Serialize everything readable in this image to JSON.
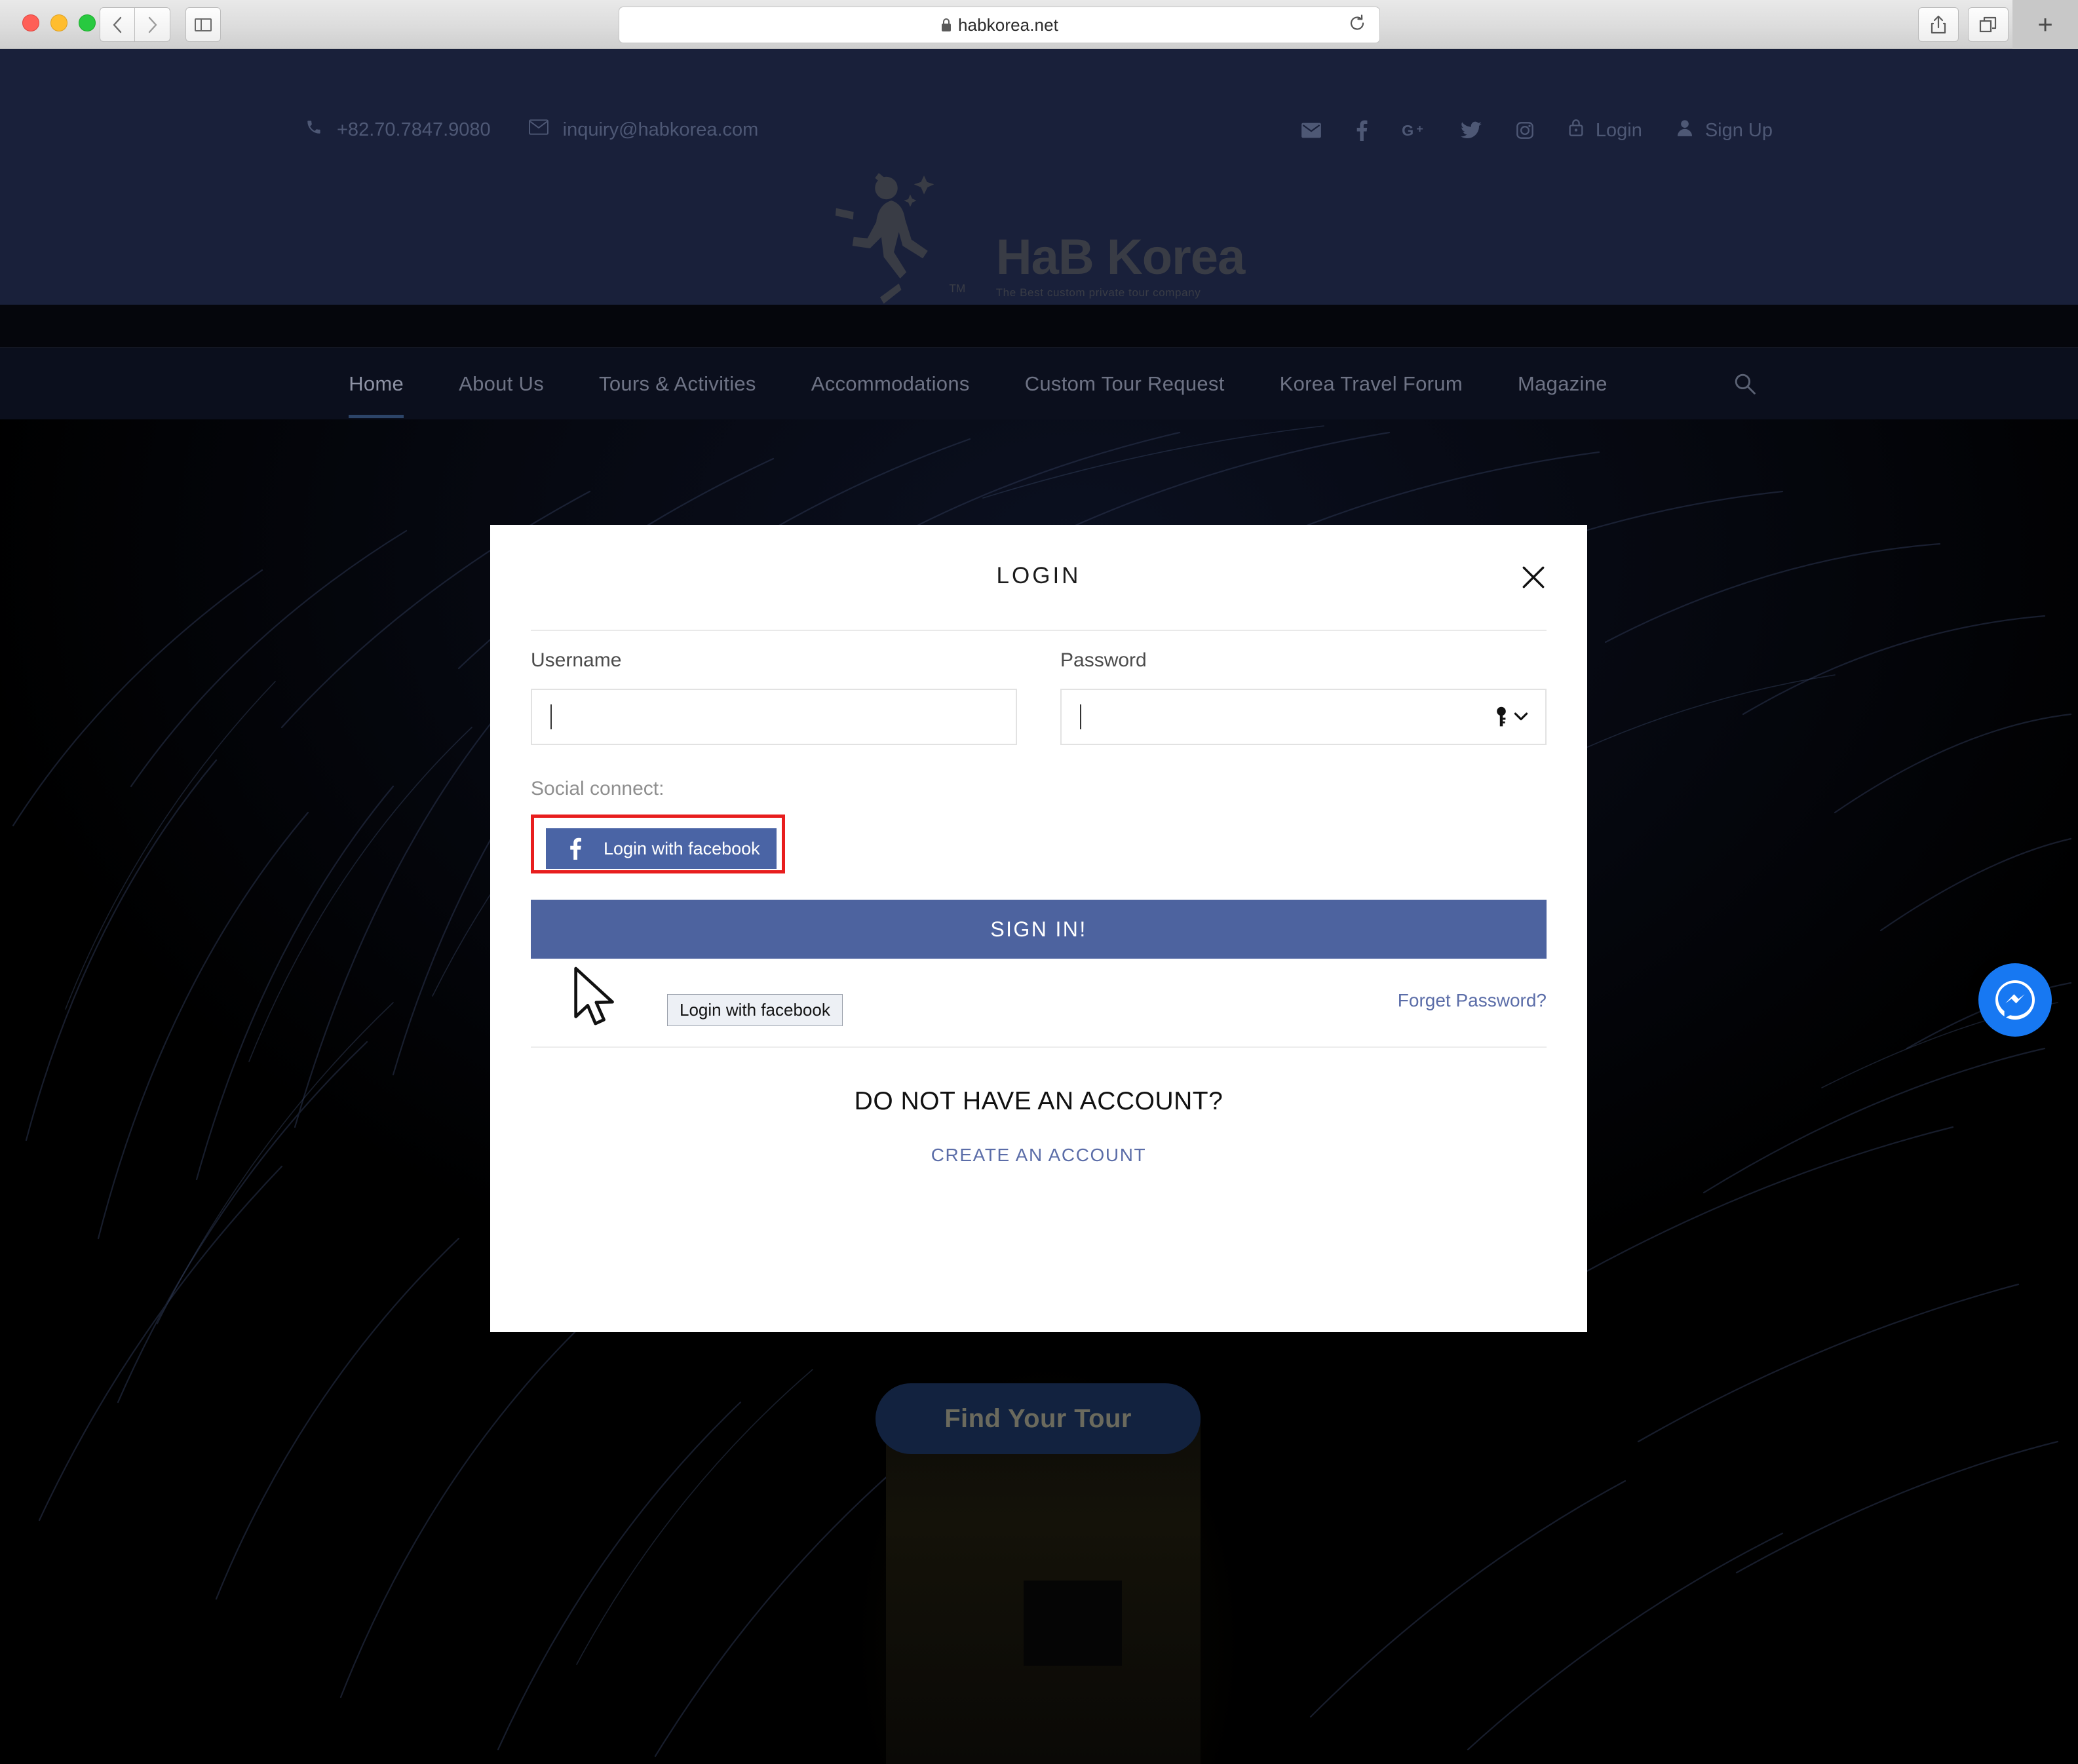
{
  "browser": {
    "url": "habkorea.net",
    "back_label": "‹",
    "forward_label": "›",
    "new_tab_label": "+",
    "icons": {
      "sidebar": "sidebar-icon",
      "lock": "lock-icon",
      "reload": "reload-icon",
      "share": "share-icon",
      "tab_overview": "tab-overview-icon"
    }
  },
  "site": {
    "topbar": {
      "phone": "+82.70.7847.9080",
      "email": "inquiry@habkorea.com",
      "social": [
        "envelope-icon",
        "facebook-icon",
        "google-plus-icon",
        "twitter-icon",
        "instagram-icon"
      ],
      "login_label": "Login",
      "signup_label": "Sign Up"
    },
    "logo": {
      "title": "HaB Korea",
      "tagline": "The Best custom private tour company",
      "trademark": "TM"
    },
    "nav": {
      "items": [
        {
          "label": "Home",
          "active": true
        },
        {
          "label": "About Us",
          "active": false
        },
        {
          "label": "Tours & Activities",
          "active": false
        },
        {
          "label": "Accommodations",
          "active": false
        },
        {
          "label": "Custom Tour Request",
          "active": false
        },
        {
          "label": "Korea Travel Forum",
          "active": false
        },
        {
          "label": "Magazine",
          "active": false
        }
      ],
      "search_icon": "search-icon"
    },
    "hero": {
      "find_tour_label": "Find Your Tour"
    },
    "messenger_bubble": "messenger-icon"
  },
  "modal": {
    "title": "LOGIN",
    "close_label": "✕",
    "username": {
      "label": "Username",
      "value": "",
      "placeholder": ""
    },
    "password": {
      "label": "Password",
      "value": "",
      "placeholder": "",
      "autofill_icon": "key-icon"
    },
    "social_connect_label": "Social connect:",
    "facebook_button_label": "Login with facebook",
    "facebook_tooltip": "Login with facebook",
    "signin_label": "SIGN IN!",
    "forget_password_label": "Forget Password?",
    "no_account_label": "DO NOT HAVE AN ACCOUNT?",
    "create_account_label": "CREATE AN ACCOUNT"
  },
  "colors": {
    "facebook_blue": "#4a64a5",
    "signin_blue": "#4d639f",
    "highlight_red": "#e81e1e",
    "link_blue": "#5b6da8",
    "header_navy": "#19203a",
    "messenger_blue": "#1778f2"
  }
}
